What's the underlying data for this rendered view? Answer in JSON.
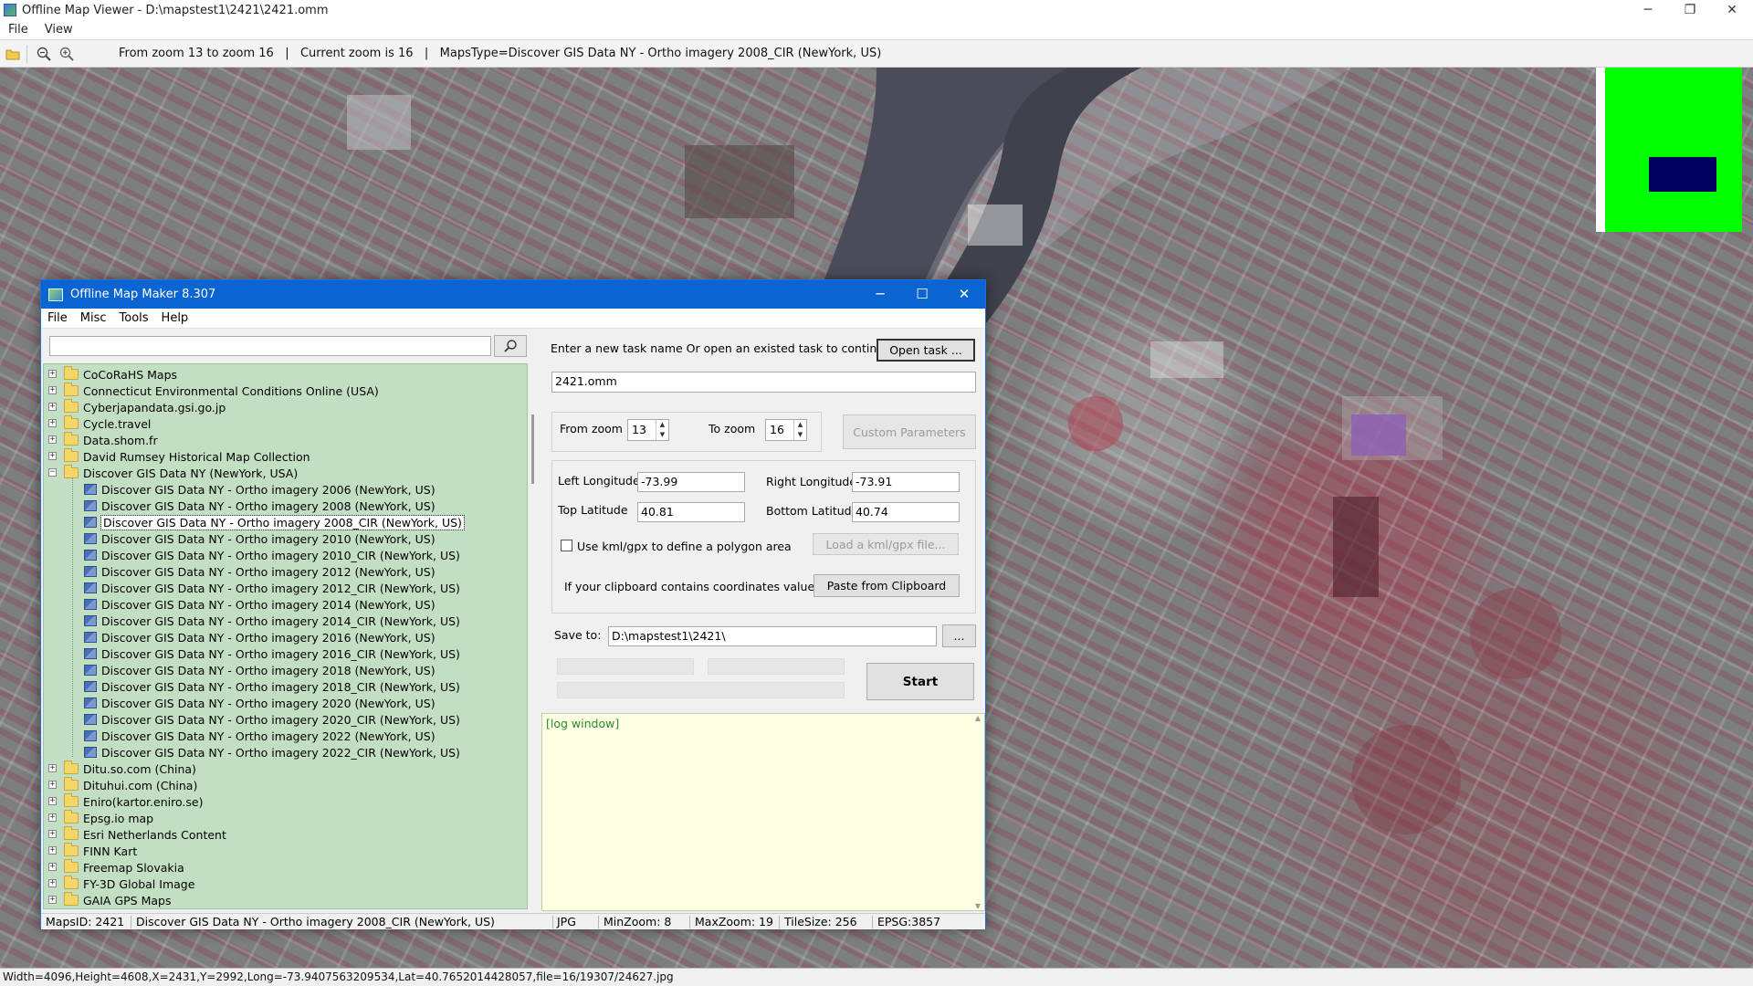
{
  "viewer": {
    "title": "Offline Map Viewer - D:\\mapstest1\\2421\\2421.omm",
    "window_buttons": [
      "─",
      "❐",
      "✕"
    ],
    "menu": [
      "File",
      "View"
    ],
    "toolbar": {
      "icons": [
        "open-folder-icon",
        "zoom-out-icon",
        "zoom-in-icon"
      ],
      "info": "From zoom 13 to zoom 16   |   Current zoom is 16   |   MapsType=Discover GIS Data NY - Ortho imagery 2008_CIR (NewYork, US)"
    },
    "status": "Width=4096,Height=4608,X=2431,Y=2992,Long=-73.9407563209534,Lat=40.7652014428057,file=16/19307/24627.jpg",
    "minimap_colors": {
      "background": "#00ff00",
      "viewport": "#00005e"
    }
  },
  "dialog": {
    "title": "Offline Map Maker 8.307",
    "window_buttons": [
      "─",
      "☐",
      "✕"
    ],
    "menu": [
      "File",
      "Misc",
      "Tools",
      "Help"
    ],
    "search": {
      "value": "",
      "placeholder": ""
    },
    "tree": {
      "before": [
        "CoCoRaHS Maps",
        "Connecticut Environmental Conditions Online (USA)",
        "Cyberjapandata.gsi.go.jp",
        "Cycle.travel",
        "Data.shom.fr",
        "David Rumsey Historical Map Collection"
      ],
      "expanded": "Discover GIS Data NY (NewYork, USA)",
      "children": [
        "Discover GIS Data NY - Ortho imagery 2006 (NewYork, US)",
        "Discover GIS Data NY - Ortho imagery 2008 (NewYork, US)",
        "Discover GIS Data NY - Ortho imagery 2008_CIR (NewYork, US)",
        "Discover GIS Data NY - Ortho imagery 2010 (NewYork, US)",
        "Discover GIS Data NY - Ortho imagery 2010_CIR (NewYork, US)",
        "Discover GIS Data NY - Ortho imagery 2012 (NewYork, US)",
        "Discover GIS Data NY - Ortho imagery 2012_CIR (NewYork, US)",
        "Discover GIS Data NY - Ortho imagery 2014 (NewYork, US)",
        "Discover GIS Data NY - Ortho imagery 2014_CIR (NewYork, US)",
        "Discover GIS Data NY - Ortho imagery 2016 (NewYork, US)",
        "Discover GIS Data NY - Ortho imagery 2016_CIR (NewYork, US)",
        "Discover GIS Data NY - Ortho imagery 2018 (NewYork, US)",
        "Discover GIS Data NY - Ortho imagery 2018_CIR (NewYork, US)",
        "Discover GIS Data NY - Ortho imagery 2020 (NewYork, US)",
        "Discover GIS Data NY - Ortho imagery 2020_CIR (NewYork, US)",
        "Discover GIS Data NY - Ortho imagery 2022 (NewYork, US)",
        "Discover GIS Data NY - Ortho imagery 2022_CIR (NewYork, US)"
      ],
      "selected_child": "Discover GIS Data NY - Ortho imagery 2008_CIR (NewYork, US)",
      "after": [
        "Ditu.so.com (China)",
        "Dituhui.com (China)",
        "Eniro(kartor.eniro.se)",
        "Epsg.io map",
        "Esri Netherlands Content",
        "FINN Kart",
        "Freemap Slovakia",
        "FY-3D Global Image",
        "GAIA GPS Maps"
      ]
    },
    "task": {
      "prompt": "Enter a new task name Or open an existed task to continue:",
      "open_button": "Open task ...",
      "name": "2421.omm"
    },
    "zoom": {
      "from_label": "From zoom",
      "from_value": "13",
      "to_label": "To zoom",
      "to_value": "16",
      "custom_button": "Custom Parameters"
    },
    "coords": {
      "left_label": "Left Longitude",
      "left_value": "-73.99",
      "right_label": "Right Longitude",
      "right_value": "-73.91",
      "top_label": "Top Latitude",
      "top_value": "40.81",
      "bottom_label": "Bottom Latitude",
      "bottom_value": "40.74",
      "kml_checkbox_label": "Use kml/gpx to define a polygon area",
      "kml_checked": false,
      "kml_button": "Load a kml/gpx file...",
      "clipboard_label": "If your clipboard contains coordinates values:",
      "clipboard_button": "Paste from Clipboard"
    },
    "save": {
      "label": "Save to:",
      "path": "D:\\mapstest1\\2421\\",
      "browse_button": "..."
    },
    "start_button": "Start",
    "log": "[log window]",
    "status": {
      "maps_id": "MapsID: 2421",
      "map_name": "Discover GIS Data NY - Ortho imagery 2008_CIR (NewYork, US)",
      "format": "JPG",
      "min_zoom": "MinZoom: 8",
      "max_zoom": "MaxZoom: 19",
      "tile_size": "TileSize: 256",
      "epsg": "EPSG:3857"
    }
  }
}
